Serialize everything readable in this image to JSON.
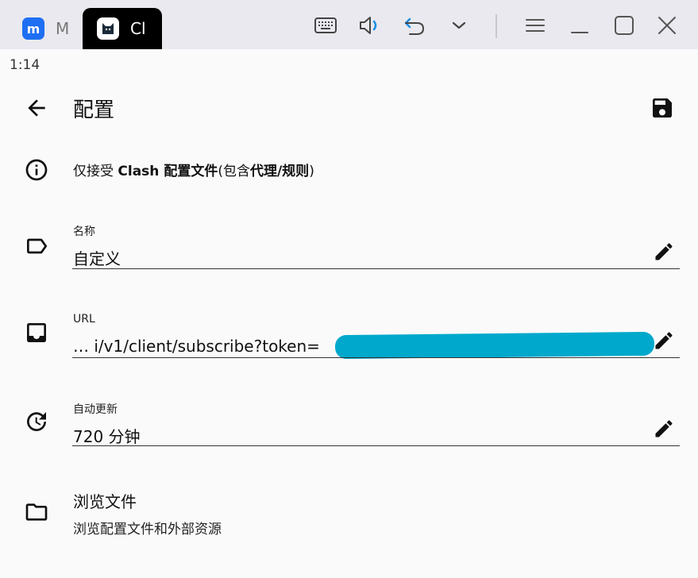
{
  "window": {
    "tabs": [
      {
        "label": "M",
        "icon": "m-app-icon"
      },
      {
        "label": "Cl",
        "icon": "cat-app-icon"
      }
    ],
    "controls": [
      "keyboard-icon",
      "volume-icon",
      "undo-icon",
      "chevron-down-icon",
      "menu-icon",
      "minimize-icon",
      "maximize-icon",
      "close-icon"
    ]
  },
  "status": {
    "time": "1:14"
  },
  "appbar": {
    "title": "配置"
  },
  "info": {
    "prefix": "仅接受 ",
    "bold1": "Clash 配置文件",
    "mid": "(包含",
    "bold2": "代理/规则",
    "suffix": ")"
  },
  "fields": {
    "name": {
      "label": "名称",
      "value": "自定义"
    },
    "url": {
      "label": "URL",
      "value": "…   i/v1/client/subscribe?token="
    },
    "auto_update": {
      "label": "自动更新",
      "value": "720 分钟"
    }
  },
  "browse": {
    "title": "浏览文件",
    "subtitle": "浏览配置文件和外部资源"
  }
}
